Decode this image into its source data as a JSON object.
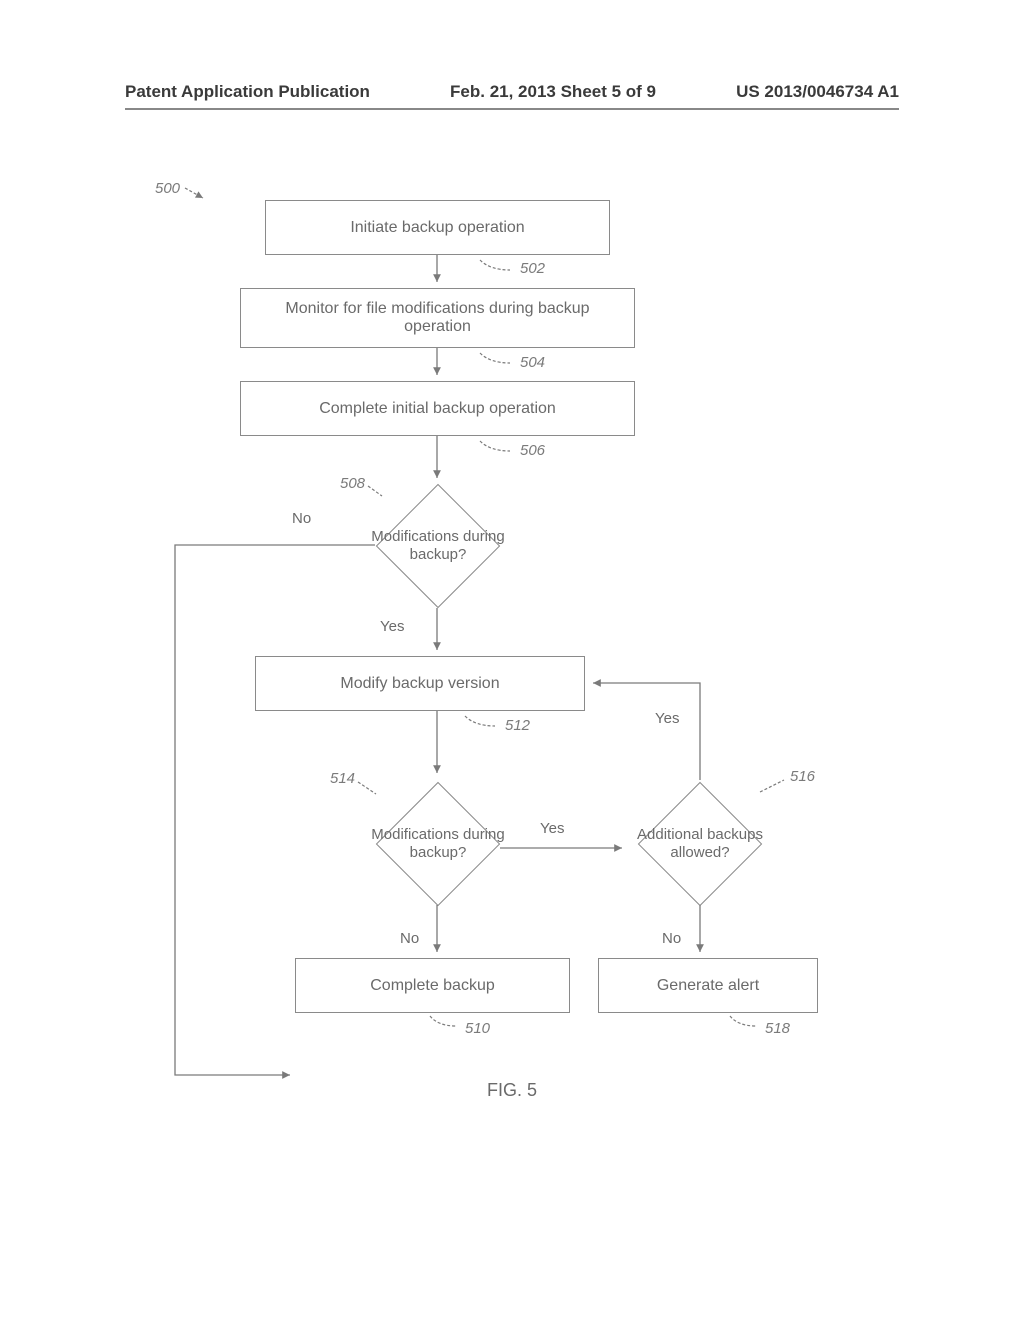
{
  "header": {
    "left": "Patent Application Publication",
    "center": "Feb. 21, 2013  Sheet 5 of 9",
    "right": "US 2013/0046734 A1"
  },
  "refs": {
    "title_ref": "500",
    "r502": "502",
    "r504": "504",
    "r506": "506",
    "r508": "508",
    "r510": "510",
    "r512": "512",
    "r514": "514",
    "r516": "516",
    "r518": "518"
  },
  "boxes": {
    "b502": "Initiate backup operation",
    "b504": "Monitor for file modifications during backup operation",
    "b506": "Complete initial backup operation",
    "b512": "Modify backup version",
    "b510": "Complete backup",
    "b518": "Generate alert"
  },
  "diamonds": {
    "d508": "Modifications during backup?",
    "d514": "Modifications during backup?",
    "d516": "Additional backups allowed?"
  },
  "edges": {
    "no": "No",
    "yes": "Yes"
  },
  "figure_label": "FIG. 5"
}
